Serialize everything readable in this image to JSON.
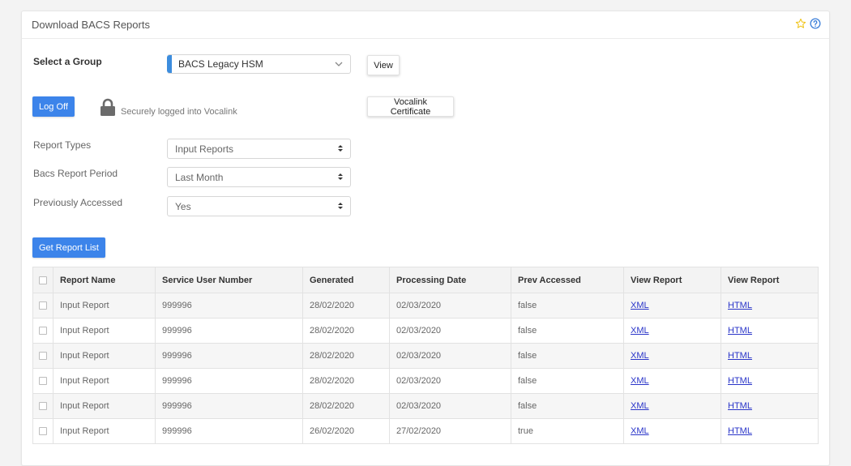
{
  "panel": {
    "title": "Download BACS Reports",
    "star_icon": "star-icon",
    "help_icon": "help-icon"
  },
  "group": {
    "label": "Select a Group",
    "value": "BACS Legacy HSM",
    "view_button": "View"
  },
  "auth": {
    "logoff_button": "Log Off",
    "lock_icon": "lock-icon",
    "status": "Securely logged into Vocalink",
    "certificate_button": "Vocalink Certificate"
  },
  "filters": {
    "report_types": {
      "label": "Report Types",
      "value": "Input Reports"
    },
    "period": {
      "label": "Bacs Report Period",
      "value": "Last Month"
    },
    "accessed": {
      "label": "Previously Accessed",
      "value": "Yes"
    }
  },
  "get_list_button": "Get Report List",
  "table": {
    "columns": [
      "Report Name",
      "Service User Number",
      "Generated",
      "Processing Date",
      "Prev Accessed",
      "View Report",
      "View Report"
    ],
    "rows": [
      [
        "Input Report",
        "999996",
        "28/02/2020",
        "02/03/2020",
        "false",
        "XML",
        "HTML"
      ],
      [
        "Input Report",
        "999996",
        "28/02/2020",
        "02/03/2020",
        "false",
        "XML",
        "HTML"
      ],
      [
        "Input Report",
        "999996",
        "28/02/2020",
        "02/03/2020",
        "false",
        "XML",
        "HTML"
      ],
      [
        "Input Report",
        "999996",
        "28/02/2020",
        "02/03/2020",
        "false",
        "XML",
        "HTML"
      ],
      [
        "Input Report",
        "999996",
        "28/02/2020",
        "02/03/2020",
        "false",
        "XML",
        "HTML"
      ],
      [
        "Input Report",
        "999996",
        "26/02/2020",
        "27/02/2020",
        "true",
        "XML",
        "HTML"
      ]
    ]
  },
  "colors": {
    "accent": "#3c84ea",
    "link": "#2a35c9",
    "star": "#f0c419",
    "help": "#3c7fd9"
  }
}
